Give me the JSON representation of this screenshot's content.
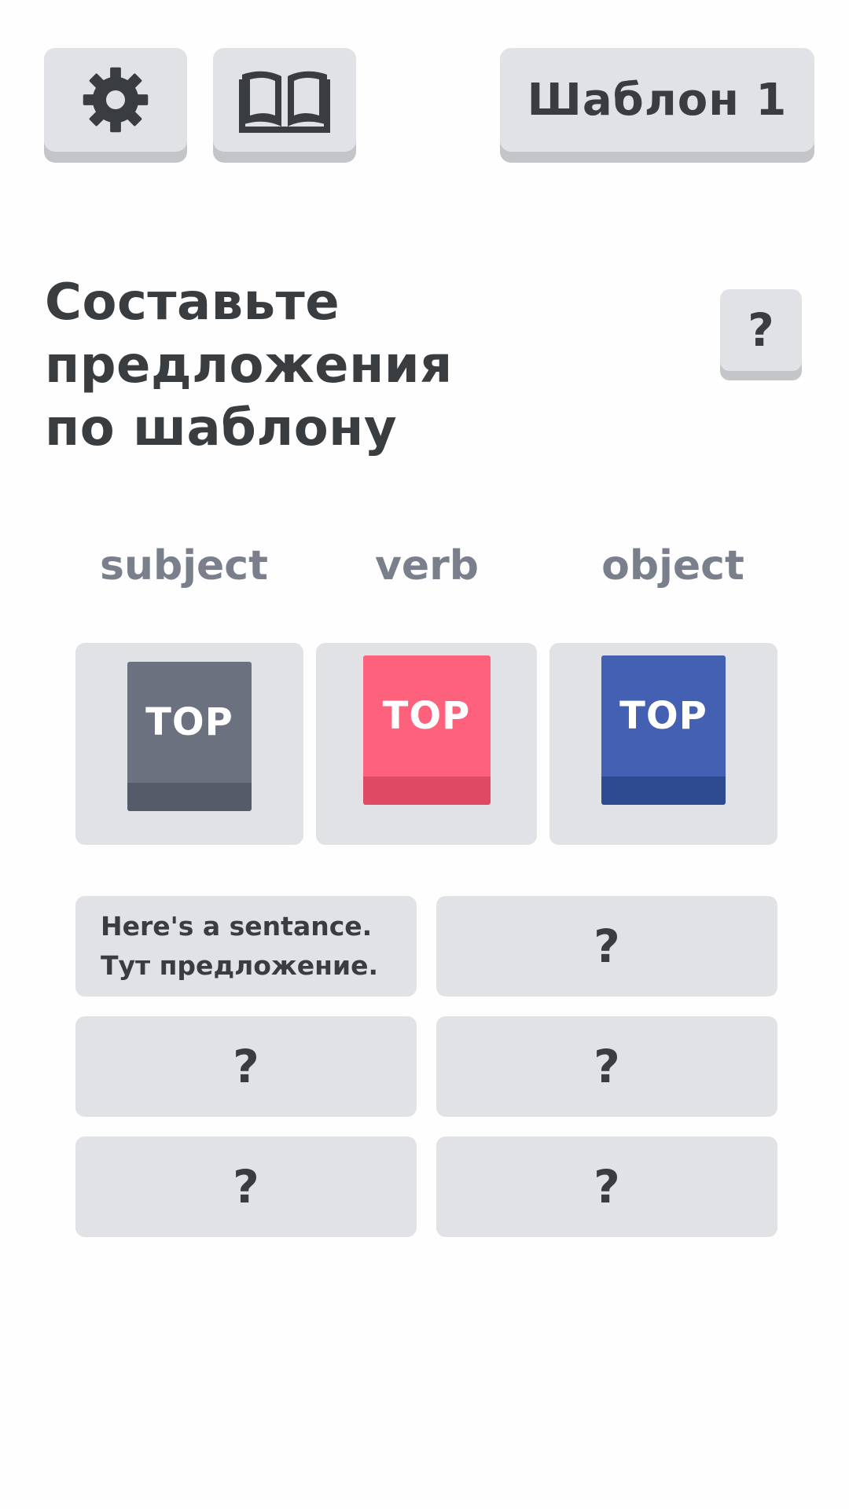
{
  "toolbar": {
    "settings_icon": "gear-icon",
    "book_icon": "open-book-icon",
    "template_label": "Шаблон 1"
  },
  "task": {
    "heading_line1": "Составьте предложения",
    "heading_line2": "по шаблону",
    "help_label": "?"
  },
  "columns": [
    {
      "label": "subject",
      "card_text": "TOP",
      "color": "#6c7180"
    },
    {
      "label": "verb",
      "card_text": "TOP",
      "color": "#fd617b"
    },
    {
      "label": "object",
      "card_text": "TOP",
      "color": "#4460b2"
    }
  ],
  "sentences": [
    {
      "line1": "Here's a sentance.",
      "line2": "Тут предложение."
    },
    {
      "placeholder": "?"
    },
    {
      "placeholder": "?"
    },
    {
      "placeholder": "?"
    },
    {
      "placeholder": "?"
    },
    {
      "placeholder": "?"
    }
  ],
  "colors": {
    "background": "#fefefe",
    "button_face": "#e1e2e5",
    "button_shadow": "#c4c5c9",
    "text_dark": "#393d40",
    "label_muted": "#7a7f8c"
  }
}
